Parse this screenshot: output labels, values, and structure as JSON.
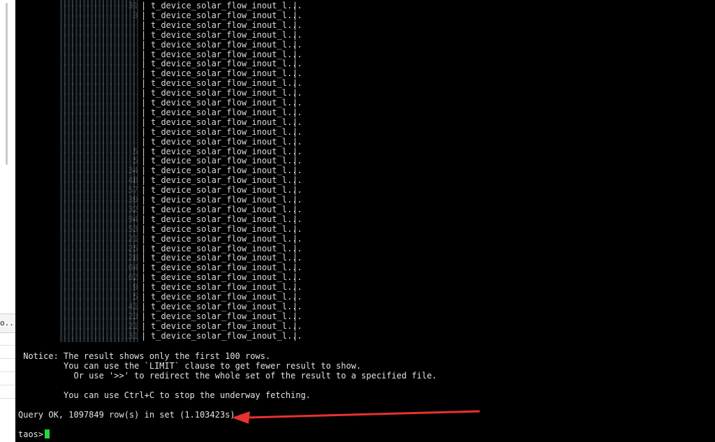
{
  "terminal": {
    "rows": [
      {
        "id": "31",
        "name": "t_device_solar_flow_inout_l..."
      },
      {
        "id": "3",
        "name": "t_device_solar_flow_inout_l..."
      },
      {
        "id": "",
        "name": "t_device_solar_flow_inout_l..."
      },
      {
        "id": "",
        "name": "t_device_solar_flow_inout_l..."
      },
      {
        "id": "",
        "name": "t_device_solar_flow_inout_l..."
      },
      {
        "id": "",
        "name": "t_device_solar_flow_inout_l..."
      },
      {
        "id": "",
        "name": "t_device_solar_flow_inout_l..."
      },
      {
        "id": "",
        "name": "t_device_solar_flow_inout_l..."
      },
      {
        "id": "",
        "name": "t_device_solar_flow_inout_l..."
      },
      {
        "id": "",
        "name": "t_device_solar_flow_inout_l..."
      },
      {
        "id": "",
        "name": "t_device_solar_flow_inout_l..."
      },
      {
        "id": "",
        "name": "t_device_solar_flow_inout_l..."
      },
      {
        "id": "",
        "name": "t_device_solar_flow_inout_l..."
      },
      {
        "id": "",
        "name": "t_device_solar_flow_inout_l..."
      },
      {
        "id": "",
        "name": "t_device_solar_flow_inout_l..."
      },
      {
        "id": "5",
        "name": "t_device_solar_flow_inout_l..."
      },
      {
        "id": "5",
        "name": "t_device_solar_flow_inout_l..."
      },
      {
        "id": "34",
        "name": "t_device_solar_flow_inout_l..."
      },
      {
        "id": "48",
        "name": "t_device_solar_flow_inout_l..."
      },
      {
        "id": "57",
        "name": "t_device_solar_flow_inout_l..."
      },
      {
        "id": "39",
        "name": "t_device_solar_flow_inout_l..."
      },
      {
        "id": "32",
        "name": "t_device_solar_flow_inout_l..."
      },
      {
        "id": "94",
        "name": "t_device_solar_flow_inout_l..."
      },
      {
        "id": "53",
        "name": "t_device_solar_flow_inout_l..."
      },
      {
        "id": "21",
        "name": "t_device_solar_flow_inout_l..."
      },
      {
        "id": "25",
        "name": "t_device_solar_flow_inout_l..."
      },
      {
        "id": "28",
        "name": "t_device_solar_flow_inout_l..."
      },
      {
        "id": "04",
        "name": "t_device_solar_flow_inout_l..."
      },
      {
        "id": "02",
        "name": "t_device_solar_flow_inout_l..."
      },
      {
        "id": "9",
        "name": "t_device_solar_flow_inout_l..."
      },
      {
        "id": "5",
        "name": "t_device_solar_flow_inout_l..."
      },
      {
        "id": "41",
        "name": "t_device_solar_flow_inout_l..."
      },
      {
        "id": "23",
        "name": "t_device_solar_flow_inout_l..."
      },
      {
        "id": "21",
        "name": "t_device_solar_flow_inout_l..."
      },
      {
        "id": "31",
        "name": "t_device_solar_flow_inout_l..."
      }
    ],
    "notice": [
      " Notice: The result shows only the first 100 rows.",
      "         You can use the `LIMIT` clause to get fewer result to show.",
      "           Or use '>>' to redirect the whole set of the result to a specified file.",
      "",
      "         You can use Ctrl+C to stop the underway fetching."
    ],
    "query_result": "Query OK, 1097849 row(s) in set (1.103423s)",
    "prompt": "taos> ",
    "cursor_color": "#22d83b",
    "arrow_color": "#e8322f"
  },
  "left_panel": {
    "tab_label": "o..."
  }
}
